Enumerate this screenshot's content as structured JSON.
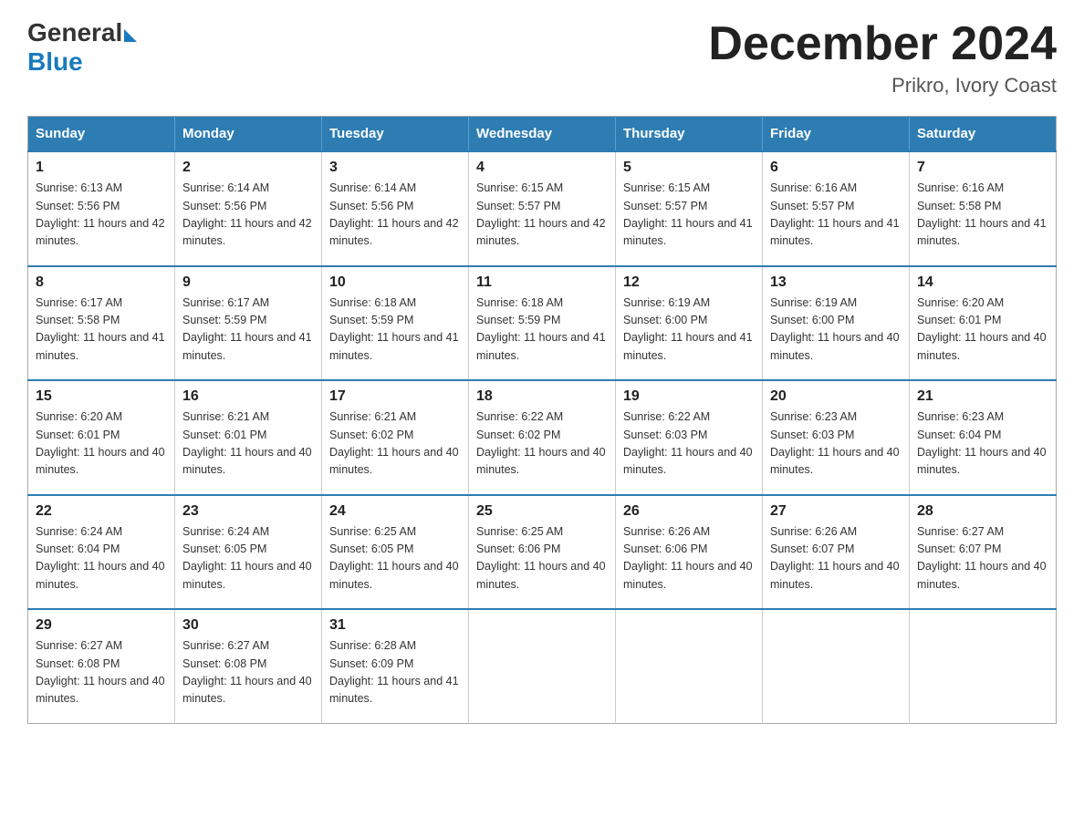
{
  "logo": {
    "general": "General",
    "blue": "Blue",
    "arrow": "▶"
  },
  "title": "December 2024",
  "subtitle": "Prikro, Ivory Coast",
  "days_of_week": [
    "Sunday",
    "Monday",
    "Tuesday",
    "Wednesday",
    "Thursday",
    "Friday",
    "Saturday"
  ],
  "weeks": [
    [
      {
        "day": "1",
        "sunrise": "6:13 AM",
        "sunset": "5:56 PM",
        "daylight": "11 hours and 42 minutes."
      },
      {
        "day": "2",
        "sunrise": "6:14 AM",
        "sunset": "5:56 PM",
        "daylight": "11 hours and 42 minutes."
      },
      {
        "day": "3",
        "sunrise": "6:14 AM",
        "sunset": "5:56 PM",
        "daylight": "11 hours and 42 minutes."
      },
      {
        "day": "4",
        "sunrise": "6:15 AM",
        "sunset": "5:57 PM",
        "daylight": "11 hours and 42 minutes."
      },
      {
        "day": "5",
        "sunrise": "6:15 AM",
        "sunset": "5:57 PM",
        "daylight": "11 hours and 41 minutes."
      },
      {
        "day": "6",
        "sunrise": "6:16 AM",
        "sunset": "5:57 PM",
        "daylight": "11 hours and 41 minutes."
      },
      {
        "day": "7",
        "sunrise": "6:16 AM",
        "sunset": "5:58 PM",
        "daylight": "11 hours and 41 minutes."
      }
    ],
    [
      {
        "day": "8",
        "sunrise": "6:17 AM",
        "sunset": "5:58 PM",
        "daylight": "11 hours and 41 minutes."
      },
      {
        "day": "9",
        "sunrise": "6:17 AM",
        "sunset": "5:59 PM",
        "daylight": "11 hours and 41 minutes."
      },
      {
        "day": "10",
        "sunrise": "6:18 AM",
        "sunset": "5:59 PM",
        "daylight": "11 hours and 41 minutes."
      },
      {
        "day": "11",
        "sunrise": "6:18 AM",
        "sunset": "5:59 PM",
        "daylight": "11 hours and 41 minutes."
      },
      {
        "day": "12",
        "sunrise": "6:19 AM",
        "sunset": "6:00 PM",
        "daylight": "11 hours and 41 minutes."
      },
      {
        "day": "13",
        "sunrise": "6:19 AM",
        "sunset": "6:00 PM",
        "daylight": "11 hours and 40 minutes."
      },
      {
        "day": "14",
        "sunrise": "6:20 AM",
        "sunset": "6:01 PM",
        "daylight": "11 hours and 40 minutes."
      }
    ],
    [
      {
        "day": "15",
        "sunrise": "6:20 AM",
        "sunset": "6:01 PM",
        "daylight": "11 hours and 40 minutes."
      },
      {
        "day": "16",
        "sunrise": "6:21 AM",
        "sunset": "6:01 PM",
        "daylight": "11 hours and 40 minutes."
      },
      {
        "day": "17",
        "sunrise": "6:21 AM",
        "sunset": "6:02 PM",
        "daylight": "11 hours and 40 minutes."
      },
      {
        "day": "18",
        "sunrise": "6:22 AM",
        "sunset": "6:02 PM",
        "daylight": "11 hours and 40 minutes."
      },
      {
        "day": "19",
        "sunrise": "6:22 AM",
        "sunset": "6:03 PM",
        "daylight": "11 hours and 40 minutes."
      },
      {
        "day": "20",
        "sunrise": "6:23 AM",
        "sunset": "6:03 PM",
        "daylight": "11 hours and 40 minutes."
      },
      {
        "day": "21",
        "sunrise": "6:23 AM",
        "sunset": "6:04 PM",
        "daylight": "11 hours and 40 minutes."
      }
    ],
    [
      {
        "day": "22",
        "sunrise": "6:24 AM",
        "sunset": "6:04 PM",
        "daylight": "11 hours and 40 minutes."
      },
      {
        "day": "23",
        "sunrise": "6:24 AM",
        "sunset": "6:05 PM",
        "daylight": "11 hours and 40 minutes."
      },
      {
        "day": "24",
        "sunrise": "6:25 AM",
        "sunset": "6:05 PM",
        "daylight": "11 hours and 40 minutes."
      },
      {
        "day": "25",
        "sunrise": "6:25 AM",
        "sunset": "6:06 PM",
        "daylight": "11 hours and 40 minutes."
      },
      {
        "day": "26",
        "sunrise": "6:26 AM",
        "sunset": "6:06 PM",
        "daylight": "11 hours and 40 minutes."
      },
      {
        "day": "27",
        "sunrise": "6:26 AM",
        "sunset": "6:07 PM",
        "daylight": "11 hours and 40 minutes."
      },
      {
        "day": "28",
        "sunrise": "6:27 AM",
        "sunset": "6:07 PM",
        "daylight": "11 hours and 40 minutes."
      }
    ],
    [
      {
        "day": "29",
        "sunrise": "6:27 AM",
        "sunset": "6:08 PM",
        "daylight": "11 hours and 40 minutes."
      },
      {
        "day": "30",
        "sunrise": "6:27 AM",
        "sunset": "6:08 PM",
        "daylight": "11 hours and 40 minutes."
      },
      {
        "day": "31",
        "sunrise": "6:28 AM",
        "sunset": "6:09 PM",
        "daylight": "11 hours and 41 minutes."
      },
      null,
      null,
      null,
      null
    ]
  ]
}
